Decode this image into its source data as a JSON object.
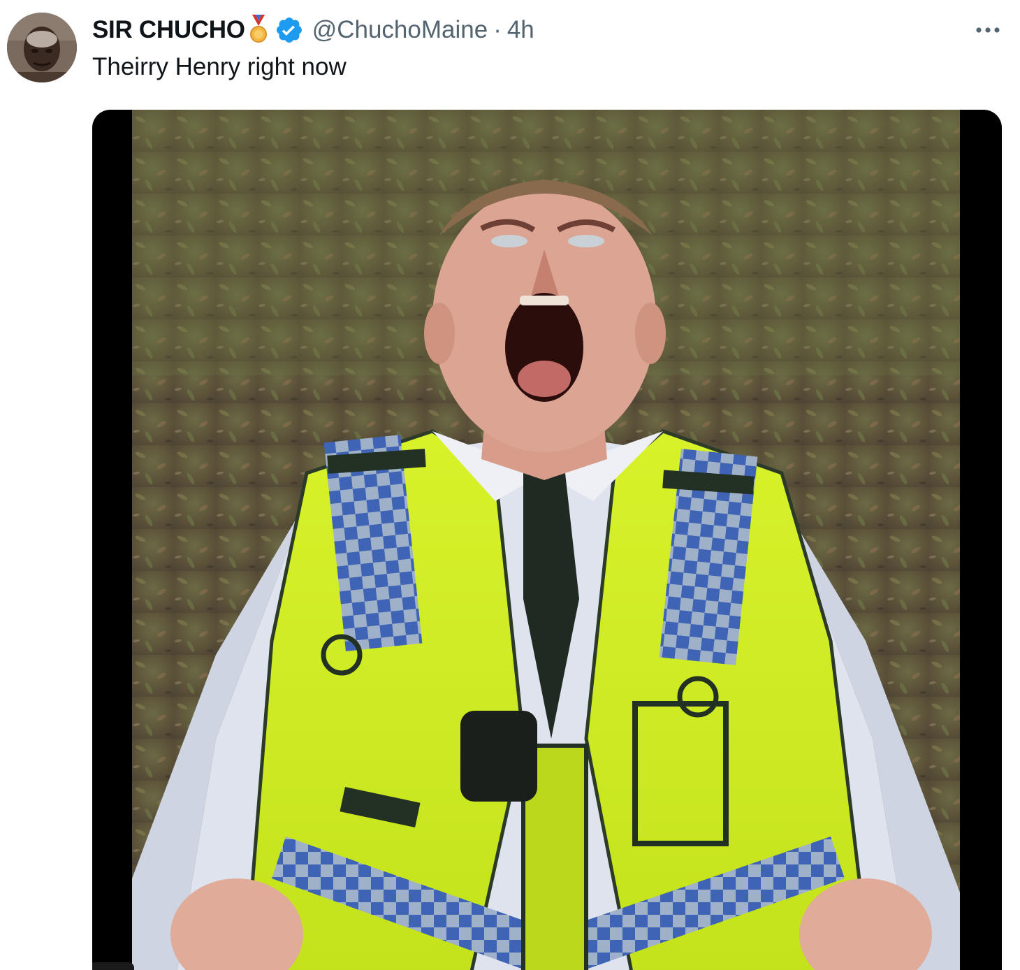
{
  "tweet": {
    "display_name": "SIR CHUCHO",
    "handle": "@ChuchoMaine",
    "separator": "·",
    "time": "4h",
    "text": "Theirry Henry right now",
    "verified_color": "#1d9bf0",
    "name_color": "#0f1419",
    "meta_color": "#536471"
  },
  "icons": {
    "medal": "medal-icon",
    "verified": "verified-badge-icon",
    "more": "more-options-icon"
  },
  "media": {
    "type": "video"
  }
}
